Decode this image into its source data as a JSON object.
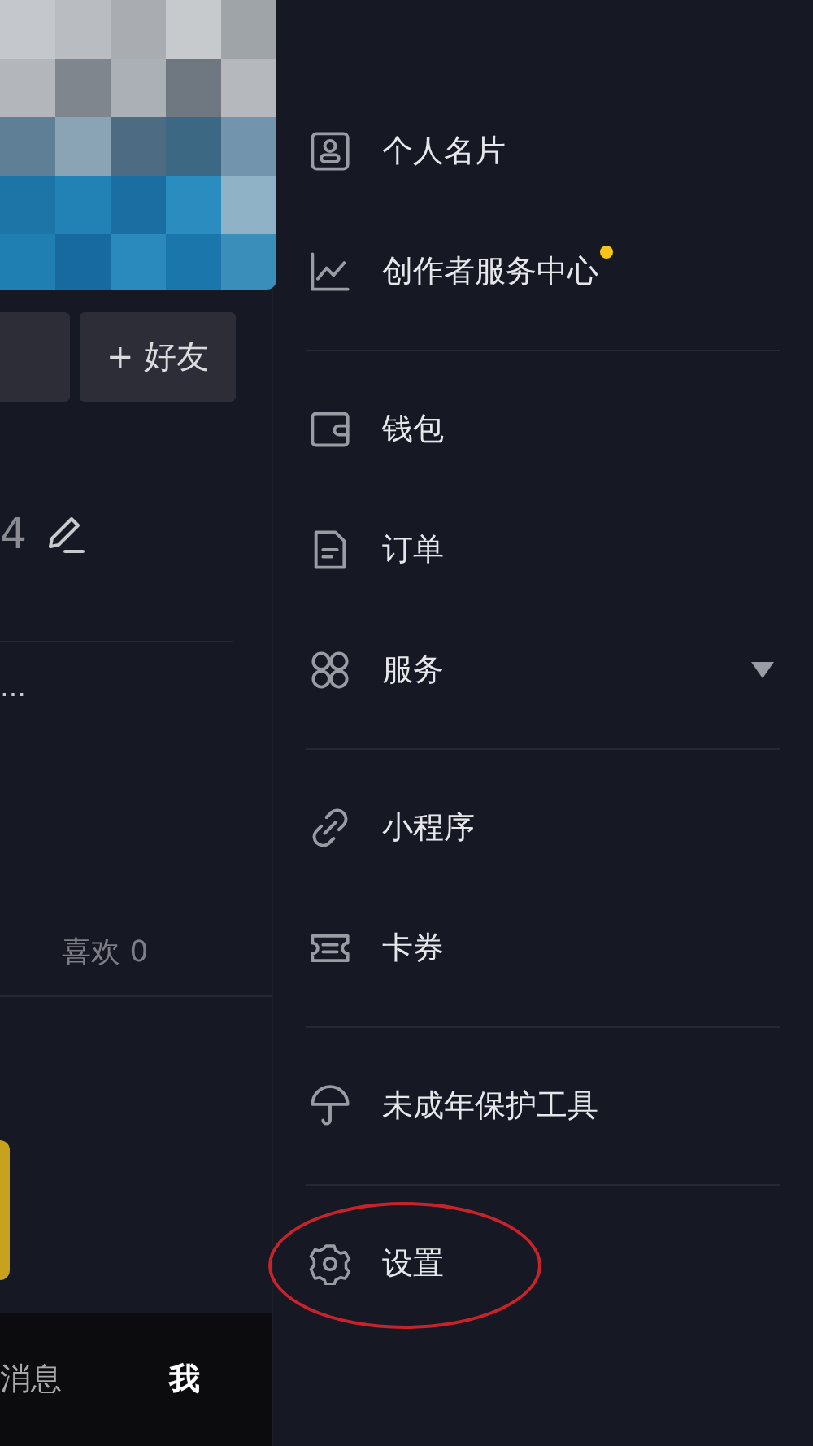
{
  "profile": {
    "add_friend_button": "+ 好友",
    "count": "4",
    "ellipsis": "…",
    "likes_tab": "喜欢 0"
  },
  "bottom_nav": [
    {
      "label": "消息",
      "selected": false
    },
    {
      "label": "我",
      "selected": true
    }
  ],
  "drawer": {
    "groups": [
      {
        "items": [
          {
            "label": "个人名片",
            "kind": "plain"
          },
          {
            "label": "创作者服务中心",
            "kind": "plain",
            "badge_dot": true
          }
        ]
      },
      {
        "items": [
          {
            "label": "钱包",
            "kind": "plain"
          },
          {
            "label": "订单",
            "kind": "plain"
          },
          {
            "label": "服务",
            "kind": "dropdown"
          }
        ]
      },
      {
        "items": [
          {
            "label": "小程序",
            "kind": "plain"
          },
          {
            "label": "卡券",
            "kind": "plain"
          }
        ]
      },
      {
        "items": [
          {
            "label": "未成年保护工具",
            "kind": "plain"
          }
        ]
      },
      {
        "items": [
          {
            "label": "设置",
            "kind": "plain",
            "circled": true
          }
        ]
      }
    ]
  }
}
